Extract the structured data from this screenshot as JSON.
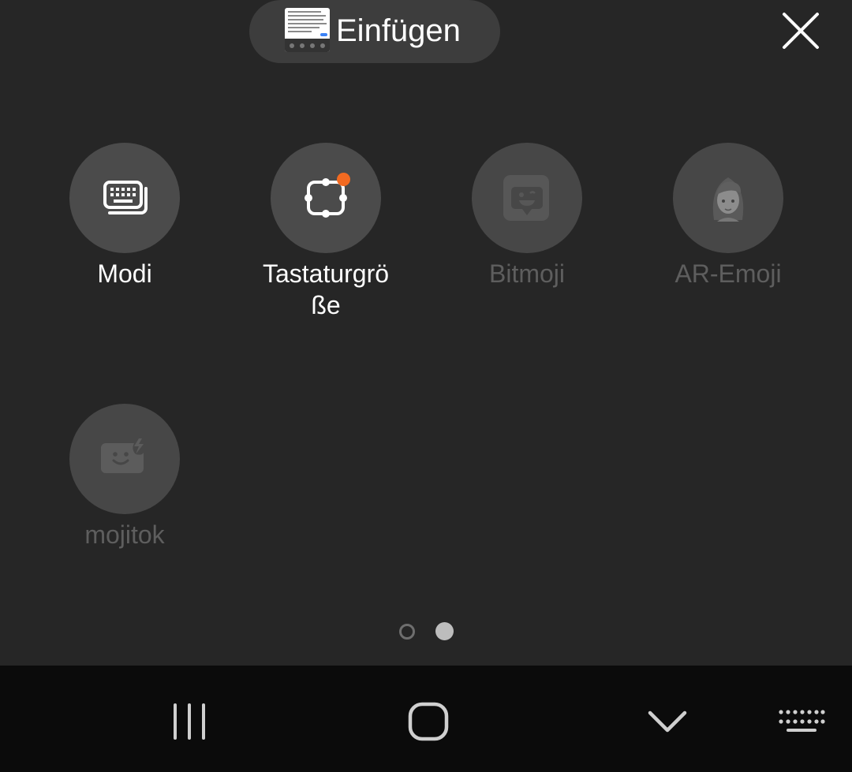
{
  "paste": {
    "label": "Einfügen"
  },
  "close": {
    "icon": "close-icon"
  },
  "items": [
    {
      "label": "Modi",
      "icon": "keyboard-modes-icon",
      "enabled": true
    },
    {
      "label_line1": "Tastaturgrö",
      "label_line2": "ße",
      "icon": "keyboard-size-icon",
      "enabled": true,
      "badge": true
    },
    {
      "label": "Bitmoji",
      "icon": "bitmoji-icon",
      "enabled": false
    },
    {
      "label": "AR-Emoji",
      "icon": "ar-emoji-avatar-icon",
      "enabled": false
    },
    {
      "label": "mojitok",
      "icon": "mojitok-icon",
      "enabled": false
    }
  ],
  "pager": {
    "pages": 2,
    "current": 2
  },
  "navbar": {
    "recents": "recents-icon",
    "home": "home-icon",
    "back": "hide-keyboard-chevron-icon",
    "keyboard": "keyboard-switch-icon"
  },
  "colors": {
    "background": "#262626",
    "pill": "#3d3d3d",
    "circle": "#4b4b4b",
    "badge": "#f26a21",
    "navbar": "#0b0b0b",
    "disabled_text": "#5e5e5e"
  }
}
